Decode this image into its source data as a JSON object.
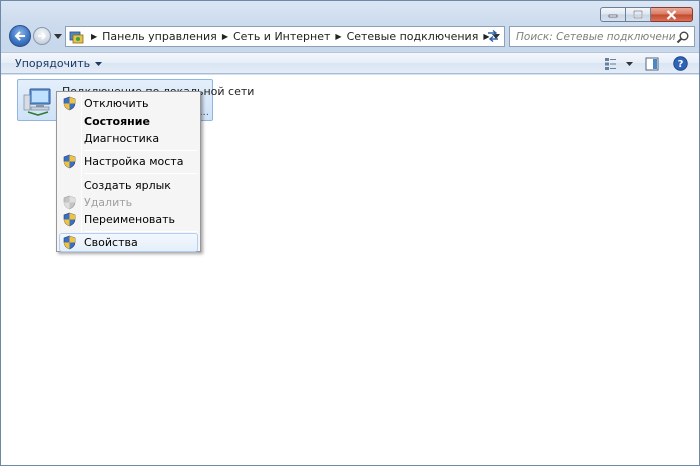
{
  "window": {
    "controls": [
      "minimize",
      "maximize",
      "close"
    ]
  },
  "address": {
    "crumbs": [
      "Панель управления",
      "Сеть и Интернет",
      "Сетевые подключения"
    ]
  },
  "search": {
    "placeholder": "Поиск: Сетевые подключения"
  },
  "toolbar": {
    "organize_label": "Упорядочить"
  },
  "connection": {
    "name": "Подключение по локальной сети",
    "more": "..."
  },
  "context_menu": {
    "items": [
      {
        "label": "Отключить",
        "shield": true
      },
      {
        "label": "Состояние",
        "bold": true
      },
      {
        "label": "Диагностика"
      },
      {
        "label": "Настройка моста",
        "shield": true
      },
      {
        "label": "Создать ярлык"
      },
      {
        "label": "Удалить",
        "shield": true,
        "disabled": true
      },
      {
        "label": "Переименовать",
        "shield": true
      },
      {
        "label": "Свойства",
        "shield": true,
        "highlighted": true
      }
    ]
  },
  "colors": {
    "accent": "#3d77c6",
    "close_button": "#c34a2c",
    "selection": "#cfe2f8"
  }
}
